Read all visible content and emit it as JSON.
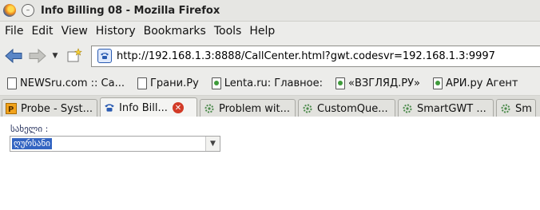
{
  "window": {
    "title": "Info Billing 08 - Mozilla Firefox"
  },
  "menu": [
    "File",
    "Edit",
    "View",
    "History",
    "Bookmarks",
    "Tools",
    "Help"
  ],
  "navbar": {
    "url": "http://192.168.1.3:8888/CallCenter.html?gwt.codesvr=192.168.1.3:9997"
  },
  "bookmarks": [
    {
      "label": "NEWSru.com :: Са...",
      "icon": "red-page-icon"
    },
    {
      "label": "Грани.Ру",
      "icon": "page-icon"
    },
    {
      "label": "Lenta.ru: Главное:",
      "icon": "page-icon"
    },
    {
      "label": "«ВЗГЛЯД.РУ»",
      "icon": "page-icon"
    },
    {
      "label": "АРИ.ру Агент",
      "icon": "page-icon"
    }
  ],
  "tabs": [
    {
      "label": "Probe - Syst...",
      "icon": "probe-icon",
      "active": false
    },
    {
      "label": "Info Bill...",
      "icon": "phone-icon",
      "active": true
    },
    {
      "label": "Problem wit...",
      "icon": "gear-icon",
      "active": false
    },
    {
      "label": "CustomQue...",
      "icon": "gear-icon",
      "active": false
    },
    {
      "label": "SmartGWT ...",
      "icon": "gear-icon",
      "active": false
    },
    {
      "label": "Sma",
      "icon": "gear-icon",
      "active": false
    }
  ],
  "form": {
    "label": "სახელი :",
    "select_value": "ღურსანი"
  }
}
